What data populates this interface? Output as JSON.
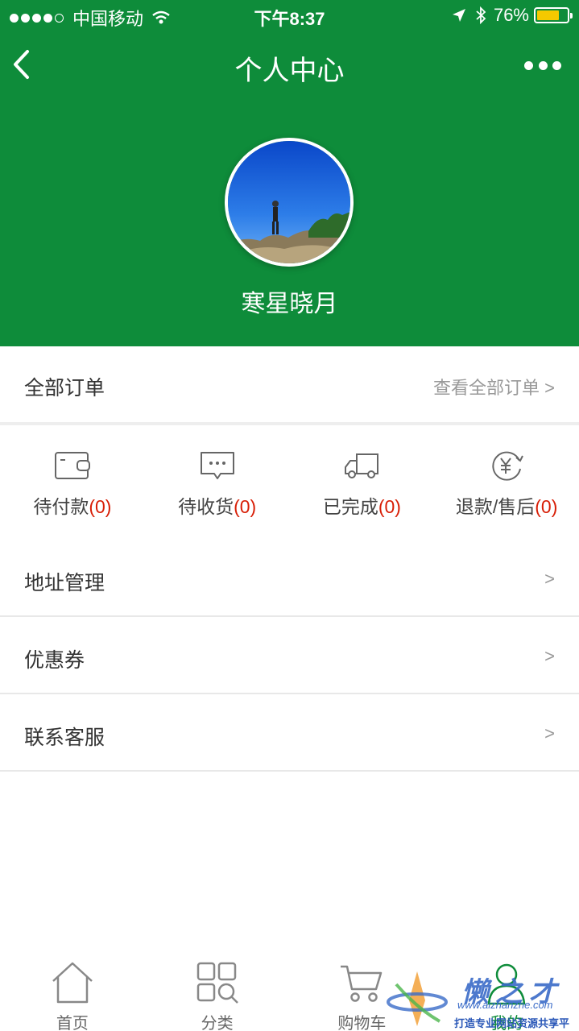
{
  "status_bar": {
    "carrier": "中国移动",
    "time": "下午8:37",
    "battery": "76%",
    "battery_level": 0.76
  },
  "nav": {
    "title": "个人中心",
    "back_icon": "chevron-left-icon",
    "more_icon": "more-dots-icon"
  },
  "profile": {
    "username": "寒星晓月"
  },
  "orders": {
    "title": "全部订单",
    "view_all": "查看全部订单 >"
  },
  "order_statuses": [
    {
      "label": "待付款",
      "count": "(0)",
      "icon": "wallet-icon"
    },
    {
      "label": "待收货",
      "count": "(0)",
      "icon": "message-icon"
    },
    {
      "label": "已完成",
      "count": "(0)",
      "icon": "truck-icon"
    },
    {
      "label": "退款/售后",
      "count": "(0)",
      "icon": "refund-yen-icon"
    }
  ],
  "menu": [
    {
      "label": "地址管理",
      "arrow": ">"
    },
    {
      "label": "优惠券",
      "arrow": ">"
    },
    {
      "label": "联系客服",
      "arrow": ">"
    }
  ],
  "tabs": [
    {
      "label": "首页",
      "icon": "home-icon"
    },
    {
      "label": "分类",
      "icon": "category-grid-icon"
    },
    {
      "label": "购物车",
      "icon": "cart-icon"
    },
    {
      "label": "我的",
      "icon": "user-icon"
    }
  ],
  "watermark": {
    "name": "懒之才",
    "url": "www.aizhanzhe.com",
    "slogan": "打造专业网站资源共享平台"
  },
  "colors": {
    "primary": "#0e8c3a",
    "count_red": "#d81e06",
    "battery_yellow": "#f5c900"
  }
}
